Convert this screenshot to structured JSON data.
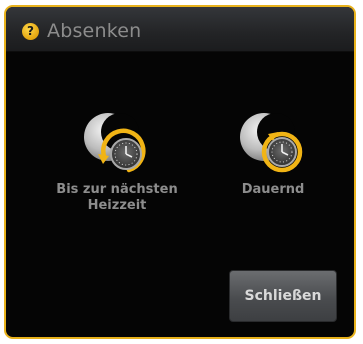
{
  "dialog": {
    "title": "Absenken",
    "help_icon": "help-icon",
    "options": [
      {
        "label": "Bis zur nächsten Heizzeit",
        "icon": "setback-until-next-heating-icon"
      },
      {
        "label": "Dauernd",
        "icon": "setback-permanent-icon"
      }
    ],
    "close_label": "Schließen"
  },
  "colors": {
    "accent": "#e8b21c",
    "background": "#050505",
    "text": "#8d8d8d"
  }
}
